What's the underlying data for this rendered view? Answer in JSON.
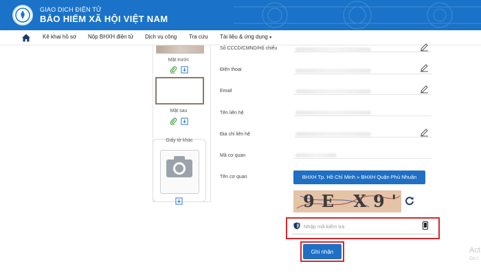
{
  "header": {
    "org_top": "GIAO DỊCH ĐIỆN TỬ",
    "org_main": "BẢO HIỂM XÃ HỘI VIỆT NAM"
  },
  "nav": {
    "items": [
      {
        "label": "Kê khai hồ sơ"
      },
      {
        "label": "Nộp BHXH điện tử"
      },
      {
        "label": "Dịch vụ công"
      },
      {
        "label": "Tra cứu"
      },
      {
        "label": "Tài liệu & ứng dụng"
      }
    ],
    "caret": "▾"
  },
  "side": {
    "front_label": "Mặt trước",
    "back_label": "Mặt sau",
    "other_label": "Giấy tờ khác"
  },
  "form": {
    "fields": [
      {
        "label": "Số CCCD/CMND/Hộ chiếu"
      },
      {
        "label": "Điện thoại"
      },
      {
        "label": "Email"
      },
      {
        "label": "Tên liên hệ"
      },
      {
        "label": "Địa chỉ liên hệ"
      },
      {
        "label": "Mã cơ quan"
      },
      {
        "label": "Tên cơ quan"
      }
    ],
    "agency_button": "BHXH Tp. Hồ Chí Minh » BHXH Quận Phú Nhuận",
    "captcha_text": "9E X9'",
    "captcha_placeholder": "Nhập mã kiểm tra",
    "submit_label": "Ghi nhận"
  },
  "watermark": {
    "line1": "Act",
    "line2": "Go t"
  },
  "colors": {
    "header_blue": "#1a73c9",
    "button_blue": "#1f6fc4",
    "highlight_red": "#d7262b"
  }
}
